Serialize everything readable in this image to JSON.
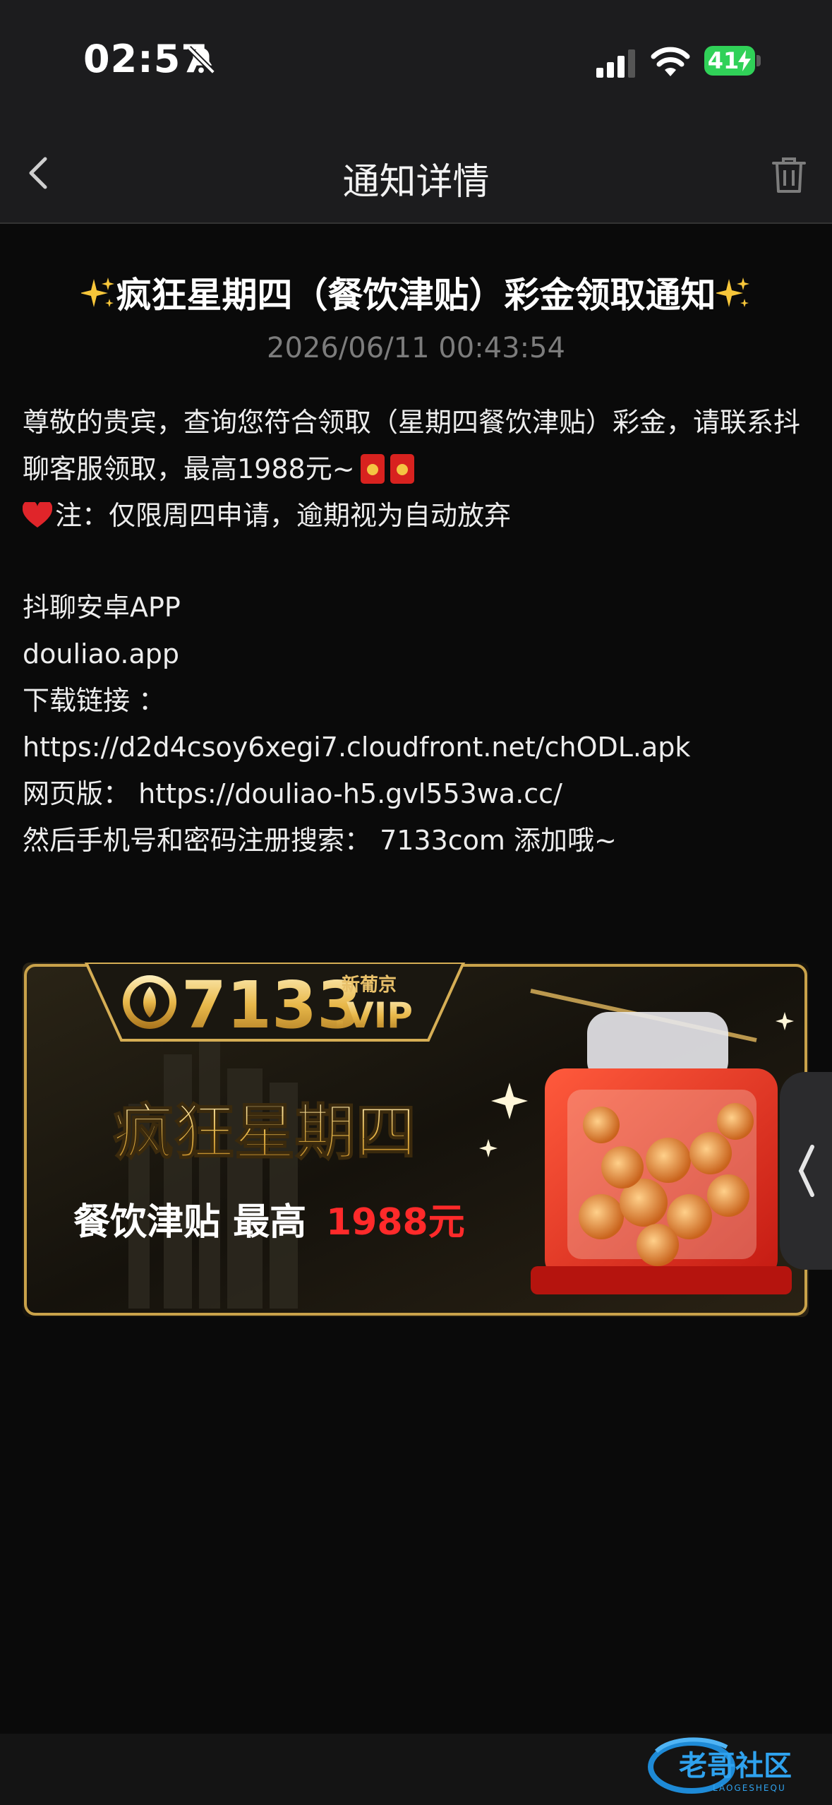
{
  "status_bar": {
    "time": "02:57",
    "battery": "41"
  },
  "nav": {
    "title": "通知详情"
  },
  "notice": {
    "title": "疯狂星期四（餐饮津贴）彩金领取通知",
    "date": "2026/06/11 00:43:54",
    "line1": "尊敬的贵宾，查询您符合领取（星期四餐饮津贴）彩金，请联系抖",
    "line2": "聊客服领取，最高1988元~",
    "line3": "注：仅限周四申请，逾期视为自动放弃",
    "line4": "抖聊安卓APP",
    "line5": "douliao.app",
    "line6": "下载链接 ：",
    "line7": " https://d2d4csoy6xegi7.cloudfront.net/chODL.apk",
    "line8": "网页版：      https://douliao-h5.gvl553wa.cc/",
    "line9": "然后手机号和密码注册搜索：       7133com     添加哦~"
  },
  "banner": {
    "logo_number": "7133",
    "logo_tld": ".VIP",
    "logo_brand": "新葡京",
    "headline": "疯狂星期四",
    "sub_prefix": "餐饮津贴 最高",
    "sub_amount": "1988元"
  },
  "watermark": {
    "cn": "老哥社区",
    "en": "LAOGESHEQU"
  }
}
